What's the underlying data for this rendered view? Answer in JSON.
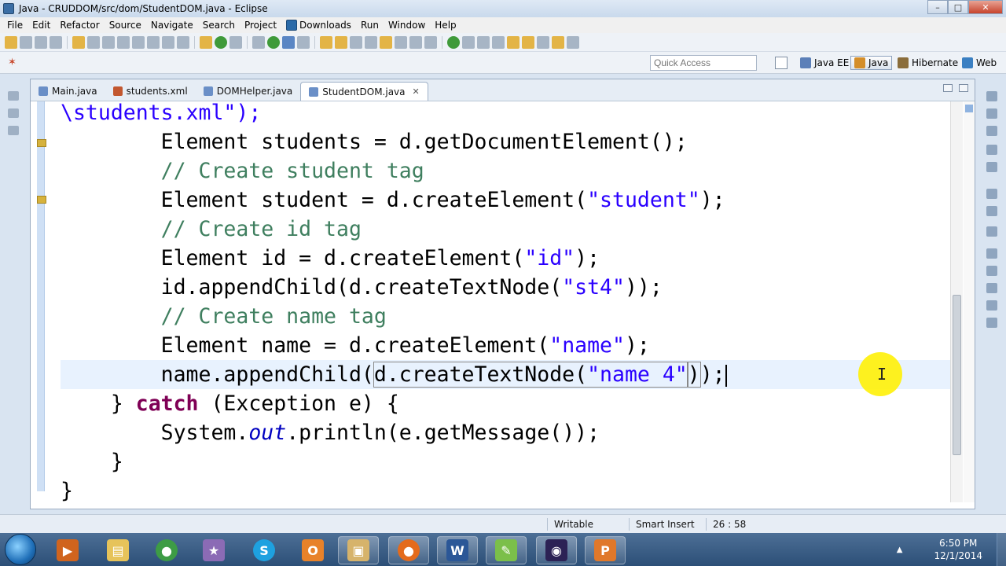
{
  "window": {
    "title": "Java - CRUDDOM/src/dom/StudentDOM.java - Eclipse",
    "minimize": "–",
    "maximize": "□",
    "close": "✕"
  },
  "menu": {
    "items": [
      "File",
      "Edit",
      "Refactor",
      "Source",
      "Navigate",
      "Search",
      "Project",
      "Downloads",
      "Run",
      "Window",
      "Help"
    ]
  },
  "toolbar2": {
    "quick_access_placeholder": "Quick Access",
    "perspectives": [
      {
        "label": "Java EE",
        "icon_color": "#5b7fb8",
        "active": false
      },
      {
        "label": "Java",
        "icon_color": "#d48e2a",
        "active": true
      },
      {
        "label": "Hibernate",
        "icon_color": "#8a6d3b",
        "active": false
      },
      {
        "label": "Web",
        "icon_color": "#3a7fc2",
        "active": false
      }
    ]
  },
  "editor": {
    "tabs": [
      {
        "label": "Main.java",
        "icon_color": "#6a8fc7",
        "active": false
      },
      {
        "label": "students.xml",
        "icon_color": "#c2572f",
        "active": false
      },
      {
        "label": "DOMHelper.java",
        "icon_color": "#6a8fc7",
        "active": false
      },
      {
        "label": "StudentDOM.java",
        "icon_color": "#6a8fc7",
        "active": true
      }
    ],
    "tab_close": "✕",
    "code": {
      "l1": "\\students.xml\");",
      "l2a": "        Element students = d.getDocumentElement();",
      "l3": "        // Create student tag",
      "l4a": "        Element student = d.createElement(",
      "l4b": "\"student\"",
      "l4c": ");",
      "l5": "        // Create id tag",
      "l6a": "        Element id = d.createElement(",
      "l6b": "\"id\"",
      "l6c": ");",
      "l7a": "        id.appendChild(d.createTextNode(",
      "l7b": "\"st4\"",
      "l7c": "));",
      "l8": "        // Create name tag",
      "l9a": "        Element name = d.createElement(",
      "l9b": "\"name\"",
      "l9c": ");",
      "l10a": "        name.appendChild(",
      "l10b": "d.createTextNode(",
      "l10c": "\"name 4\"",
      "l10d": ")",
      "l10e": ");",
      "l11a": "    } ",
      "l11b": "catch",
      "l11c": " (Exception e) {",
      "l12a": "        System.",
      "l12b": "out",
      "l12c": ".println(e.getMessage());",
      "l13": "    }",
      "l14": "}"
    },
    "ibeam": "I"
  },
  "status": {
    "writable": "Writable",
    "insert_mode": "Smart Insert",
    "position": "26 : 58"
  },
  "taskbar": {
    "apps": [
      {
        "name": "camtasia",
        "color": "#d0641e",
        "glyph": "▶",
        "running": false
      },
      {
        "name": "explorer",
        "color": "#e6c35a",
        "glyph": "▤",
        "running": false
      },
      {
        "name": "chrome",
        "color": "#3d9c45",
        "glyph": "●",
        "running": false
      },
      {
        "name": "game",
        "color": "#8b6bb5",
        "glyph": "★",
        "running": false
      },
      {
        "name": "skype",
        "color": "#1ea1e0",
        "glyph": "S",
        "running": false
      },
      {
        "name": "outlook",
        "color": "#e8822a",
        "glyph": "O",
        "running": false
      },
      {
        "name": "folder",
        "color": "#d6b36b",
        "glyph": "▣",
        "running": true
      },
      {
        "name": "firefox",
        "color": "#e46b1c",
        "glyph": "●",
        "running": true
      },
      {
        "name": "word",
        "color": "#2b5797",
        "glyph": "W",
        "running": true
      },
      {
        "name": "notepad-plus",
        "color": "#7bbf4a",
        "glyph": "✎",
        "running": true
      },
      {
        "name": "eclipse",
        "color": "#2c2255",
        "glyph": "◉",
        "running": true
      },
      {
        "name": "pdf",
        "color": "#e0782a",
        "glyph": "P",
        "running": true
      }
    ],
    "tray_arrow": "▲",
    "clock_time": "6:50 PM",
    "clock_date": "12/1/2014"
  }
}
